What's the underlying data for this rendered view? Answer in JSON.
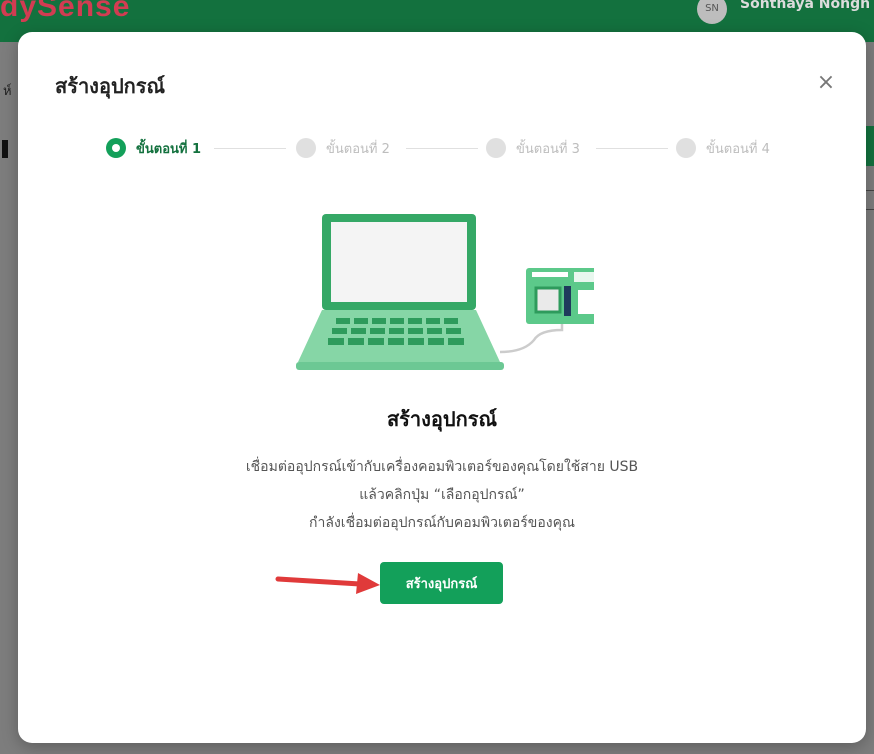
{
  "background": {
    "brand": "dySense",
    "avatar_initials": "SN",
    "username": "Sonthaya Nongn",
    "left_fragment": "ห์"
  },
  "modal": {
    "title": "สร้างอุปกรณ์",
    "close_label": "×",
    "steps": [
      {
        "label": "ขั้นตอนที่ 1",
        "active": true
      },
      {
        "label": "ขั้นตอนที่ 2",
        "active": false
      },
      {
        "label": "ขั้นตอนที่ 3",
        "active": false
      },
      {
        "label": "ขั้นตอนที่ 4",
        "active": false
      }
    ],
    "content_title": "สร้างอุปกรณ์",
    "description_lines": [
      "เชื่อมต่ออุปกรณ์เข้ากับเครื่องคอมพิวเตอร์ของคุณโดยใช้สาย USB",
      "แล้วคลิกปุ่ม “เลือกอุปกรณ์”",
      "กำลังเชื่อมต่ออุปกรณ์กับคอมพิวเตอร์ของคุณ"
    ],
    "button_label": "สร้างอุปกรณ์"
  },
  "colors": {
    "brand_green": "#13713e",
    "accent_green": "#13a05a",
    "illustration_green": "#5cc98a",
    "arrow_red": "#e03a3a"
  },
  "icons": {
    "close": "close-icon",
    "illustration": "laptop-with-board-illustration",
    "annotation": "red-arrow-icon"
  }
}
